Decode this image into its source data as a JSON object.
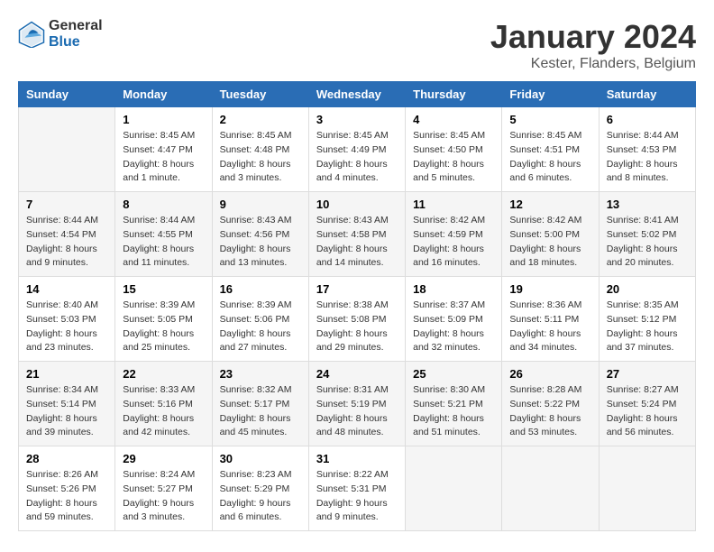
{
  "header": {
    "logo_general": "General",
    "logo_blue": "Blue",
    "main_title": "January 2024",
    "subtitle": "Kester, Flanders, Belgium"
  },
  "calendar": {
    "days_of_week": [
      "Sunday",
      "Monday",
      "Tuesday",
      "Wednesday",
      "Thursday",
      "Friday",
      "Saturday"
    ],
    "weeks": [
      [
        {
          "day": "",
          "sunrise": "",
          "sunset": "",
          "daylight": ""
        },
        {
          "day": "1",
          "sunrise": "Sunrise: 8:45 AM",
          "sunset": "Sunset: 4:47 PM",
          "daylight": "Daylight: 8 hours and 1 minute."
        },
        {
          "day": "2",
          "sunrise": "Sunrise: 8:45 AM",
          "sunset": "Sunset: 4:48 PM",
          "daylight": "Daylight: 8 hours and 3 minutes."
        },
        {
          "day": "3",
          "sunrise": "Sunrise: 8:45 AM",
          "sunset": "Sunset: 4:49 PM",
          "daylight": "Daylight: 8 hours and 4 minutes."
        },
        {
          "day": "4",
          "sunrise": "Sunrise: 8:45 AM",
          "sunset": "Sunset: 4:50 PM",
          "daylight": "Daylight: 8 hours and 5 minutes."
        },
        {
          "day": "5",
          "sunrise": "Sunrise: 8:45 AM",
          "sunset": "Sunset: 4:51 PM",
          "daylight": "Daylight: 8 hours and 6 minutes."
        },
        {
          "day": "6",
          "sunrise": "Sunrise: 8:44 AM",
          "sunset": "Sunset: 4:53 PM",
          "daylight": "Daylight: 8 hours and 8 minutes."
        }
      ],
      [
        {
          "day": "7",
          "sunrise": "Sunrise: 8:44 AM",
          "sunset": "Sunset: 4:54 PM",
          "daylight": "Daylight: 8 hours and 9 minutes."
        },
        {
          "day": "8",
          "sunrise": "Sunrise: 8:44 AM",
          "sunset": "Sunset: 4:55 PM",
          "daylight": "Daylight: 8 hours and 11 minutes."
        },
        {
          "day": "9",
          "sunrise": "Sunrise: 8:43 AM",
          "sunset": "Sunset: 4:56 PM",
          "daylight": "Daylight: 8 hours and 13 minutes."
        },
        {
          "day": "10",
          "sunrise": "Sunrise: 8:43 AM",
          "sunset": "Sunset: 4:58 PM",
          "daylight": "Daylight: 8 hours and 14 minutes."
        },
        {
          "day": "11",
          "sunrise": "Sunrise: 8:42 AM",
          "sunset": "Sunset: 4:59 PM",
          "daylight": "Daylight: 8 hours and 16 minutes."
        },
        {
          "day": "12",
          "sunrise": "Sunrise: 8:42 AM",
          "sunset": "Sunset: 5:00 PM",
          "daylight": "Daylight: 8 hours and 18 minutes."
        },
        {
          "day": "13",
          "sunrise": "Sunrise: 8:41 AM",
          "sunset": "Sunset: 5:02 PM",
          "daylight": "Daylight: 8 hours and 20 minutes."
        }
      ],
      [
        {
          "day": "14",
          "sunrise": "Sunrise: 8:40 AM",
          "sunset": "Sunset: 5:03 PM",
          "daylight": "Daylight: 8 hours and 23 minutes."
        },
        {
          "day": "15",
          "sunrise": "Sunrise: 8:39 AM",
          "sunset": "Sunset: 5:05 PM",
          "daylight": "Daylight: 8 hours and 25 minutes."
        },
        {
          "day": "16",
          "sunrise": "Sunrise: 8:39 AM",
          "sunset": "Sunset: 5:06 PM",
          "daylight": "Daylight: 8 hours and 27 minutes."
        },
        {
          "day": "17",
          "sunrise": "Sunrise: 8:38 AM",
          "sunset": "Sunset: 5:08 PM",
          "daylight": "Daylight: 8 hours and 29 minutes."
        },
        {
          "day": "18",
          "sunrise": "Sunrise: 8:37 AM",
          "sunset": "Sunset: 5:09 PM",
          "daylight": "Daylight: 8 hours and 32 minutes."
        },
        {
          "day": "19",
          "sunrise": "Sunrise: 8:36 AM",
          "sunset": "Sunset: 5:11 PM",
          "daylight": "Daylight: 8 hours and 34 minutes."
        },
        {
          "day": "20",
          "sunrise": "Sunrise: 8:35 AM",
          "sunset": "Sunset: 5:12 PM",
          "daylight": "Daylight: 8 hours and 37 minutes."
        }
      ],
      [
        {
          "day": "21",
          "sunrise": "Sunrise: 8:34 AM",
          "sunset": "Sunset: 5:14 PM",
          "daylight": "Daylight: 8 hours and 39 minutes."
        },
        {
          "day": "22",
          "sunrise": "Sunrise: 8:33 AM",
          "sunset": "Sunset: 5:16 PM",
          "daylight": "Daylight: 8 hours and 42 minutes."
        },
        {
          "day": "23",
          "sunrise": "Sunrise: 8:32 AM",
          "sunset": "Sunset: 5:17 PM",
          "daylight": "Daylight: 8 hours and 45 minutes."
        },
        {
          "day": "24",
          "sunrise": "Sunrise: 8:31 AM",
          "sunset": "Sunset: 5:19 PM",
          "daylight": "Daylight: 8 hours and 48 minutes."
        },
        {
          "day": "25",
          "sunrise": "Sunrise: 8:30 AM",
          "sunset": "Sunset: 5:21 PM",
          "daylight": "Daylight: 8 hours and 51 minutes."
        },
        {
          "day": "26",
          "sunrise": "Sunrise: 8:28 AM",
          "sunset": "Sunset: 5:22 PM",
          "daylight": "Daylight: 8 hours and 53 minutes."
        },
        {
          "day": "27",
          "sunrise": "Sunrise: 8:27 AM",
          "sunset": "Sunset: 5:24 PM",
          "daylight": "Daylight: 8 hours and 56 minutes."
        }
      ],
      [
        {
          "day": "28",
          "sunrise": "Sunrise: 8:26 AM",
          "sunset": "Sunset: 5:26 PM",
          "daylight": "Daylight: 8 hours and 59 minutes."
        },
        {
          "day": "29",
          "sunrise": "Sunrise: 8:24 AM",
          "sunset": "Sunset: 5:27 PM",
          "daylight": "Daylight: 9 hours and 3 minutes."
        },
        {
          "day": "30",
          "sunrise": "Sunrise: 8:23 AM",
          "sunset": "Sunset: 5:29 PM",
          "daylight": "Daylight: 9 hours and 6 minutes."
        },
        {
          "day": "31",
          "sunrise": "Sunrise: 8:22 AM",
          "sunset": "Sunset: 5:31 PM",
          "daylight": "Daylight: 9 hours and 9 minutes."
        },
        {
          "day": "",
          "sunrise": "",
          "sunset": "",
          "daylight": ""
        },
        {
          "day": "",
          "sunrise": "",
          "sunset": "",
          "daylight": ""
        },
        {
          "day": "",
          "sunrise": "",
          "sunset": "",
          "daylight": ""
        }
      ]
    ]
  }
}
